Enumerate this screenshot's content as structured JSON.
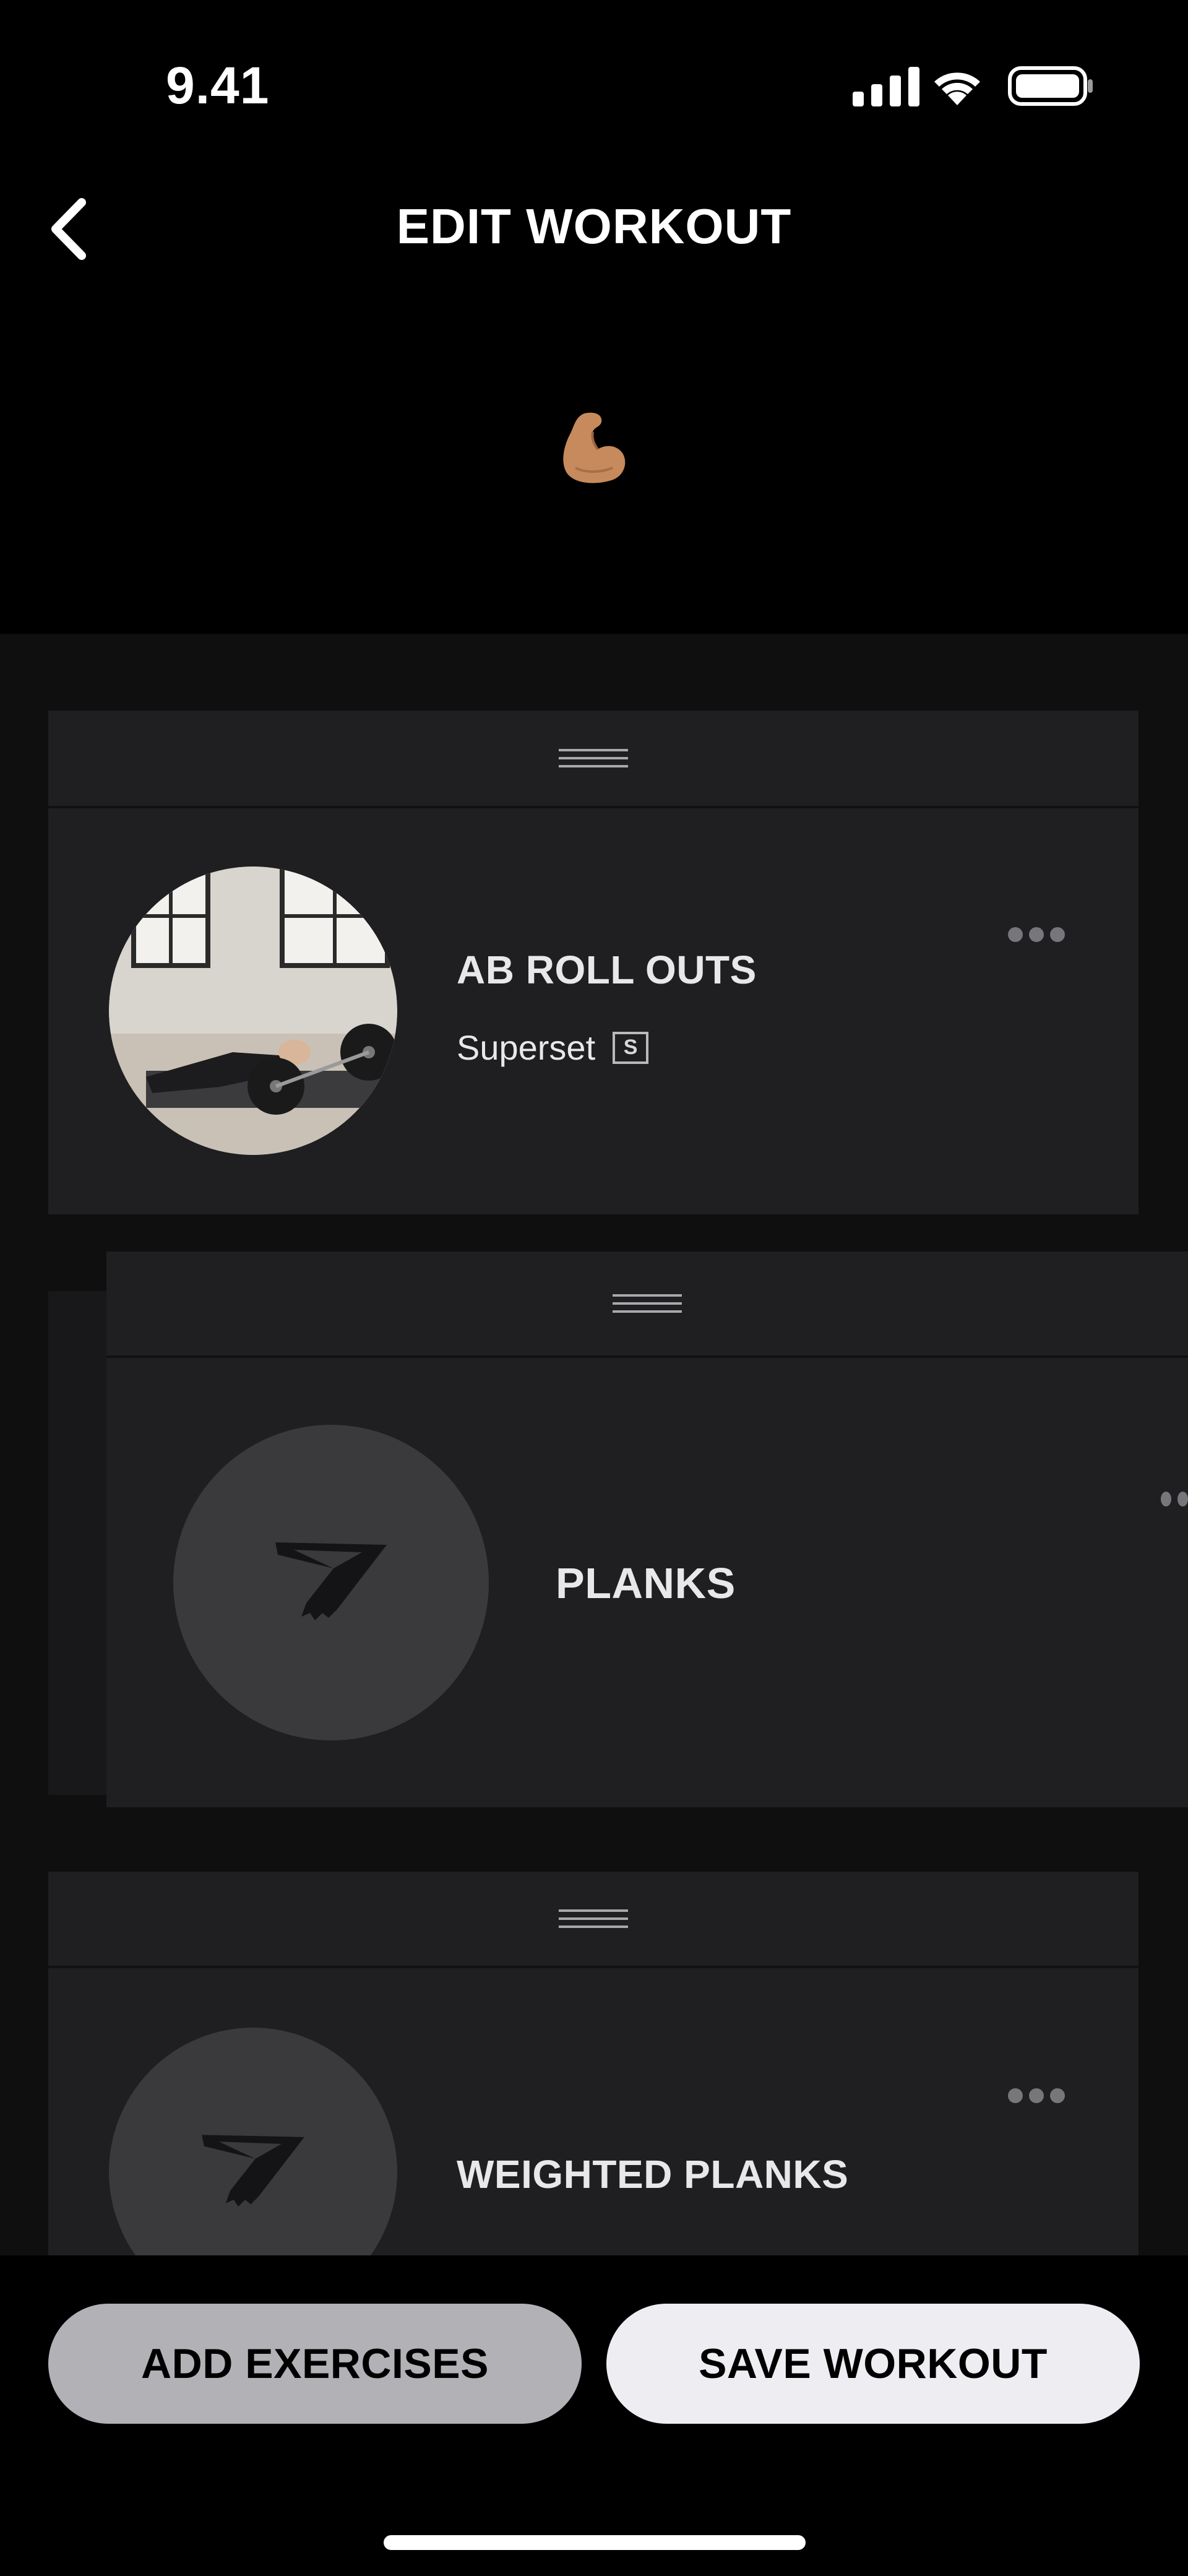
{
  "status_bar": {
    "time": "9.41"
  },
  "header": {
    "title": "EDIT WORKOUT",
    "emoji": "💪"
  },
  "exercises": [
    {
      "name": "AB ROLL OUTS",
      "subtitle": "Superset",
      "badge": "S"
    },
    {
      "name": "PLANKS"
    },
    {
      "name": "WEIGHTED PLANKS"
    }
  ],
  "footer": {
    "add_label": "ADD EXERCISES",
    "save_label": "SAVE WORKOUT"
  },
  "colors": {
    "background": "#0f0f10",
    "card": "#1f1f21",
    "placeholder": "#3a3a3c",
    "add_button": "#b2b2b6",
    "save_button": "#eeeef2"
  }
}
